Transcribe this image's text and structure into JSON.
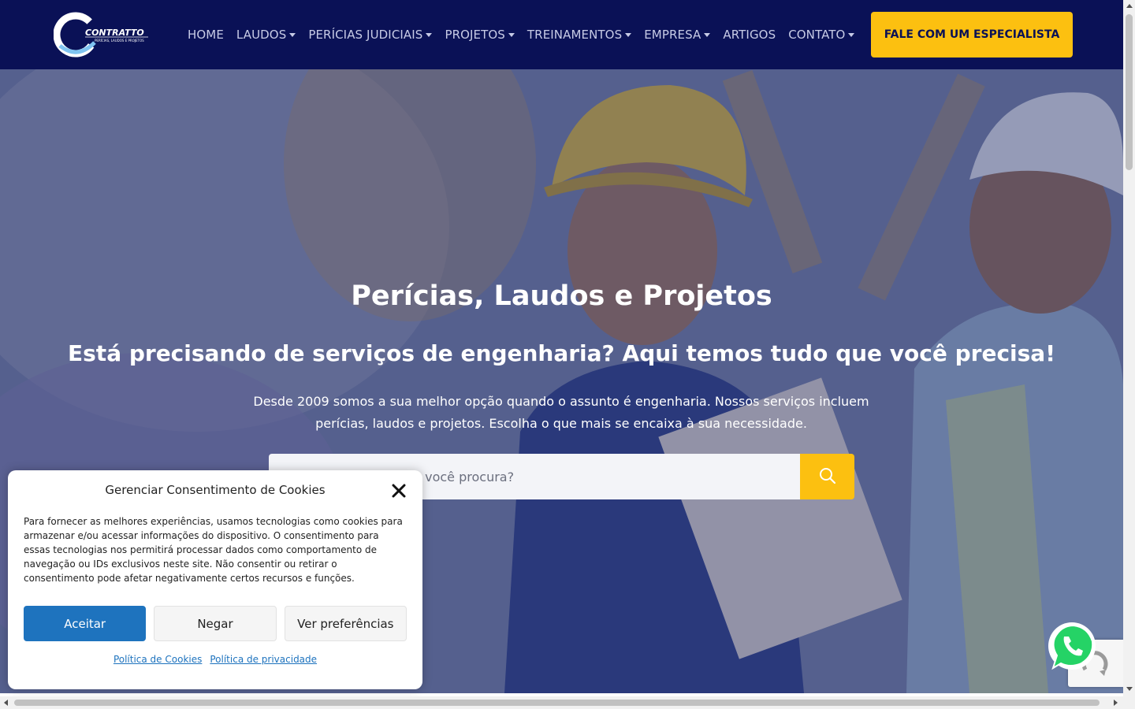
{
  "brand": {
    "logo_text": "CONTRATTO",
    "logo_tagline": "PERÍCIAS, LAUDOS E PROJETOS"
  },
  "nav": {
    "items": [
      {
        "label": "HOME",
        "dropdown": false
      },
      {
        "label": "LAUDOS",
        "dropdown": true
      },
      {
        "label": "PERÍCIAS JUDICIAIS",
        "dropdown": true
      },
      {
        "label": "PROJETOS",
        "dropdown": true
      },
      {
        "label": "TREINAMENTOS",
        "dropdown": true
      },
      {
        "label": "EMPRESA",
        "dropdown": true
      },
      {
        "label": "ARTIGOS",
        "dropdown": false
      },
      {
        "label": "CONTATO",
        "dropdown": true
      }
    ],
    "cta_label": "FALE COM UM ESPECIALISTA"
  },
  "hero": {
    "title": "Perícias, Laudos e Projetos",
    "subtitle": "Está precisando de serviços de engenharia? Aqui temos tudo que você precisa!",
    "description": "Desde 2009 somos a sua melhor opção quando o assunto é engenharia. Nossos serviços incluem perícias, laudos e projetos. Escolha o que mais se encaixa à sua necessidade.",
    "search_placeholder": "Qual laudo ou projeto você procura?"
  },
  "cookie": {
    "title": "Gerenciar Consentimento de Cookies",
    "text": "Para fornecer as melhores experiências, usamos tecnologias como cookies para armazenar e/ou acessar informações do dispositivo. O consentimento para essas tecnologias nos permitirá processar dados como comportamento de navegação ou IDs exclusivos neste site. Não consentir ou retirar o consentimento pode afetar negativamente certos recursos e funções.",
    "accept_label": "Aceitar",
    "deny_label": "Negar",
    "prefs_label": "Ver preferências",
    "cookie_policy_label": "Política de Cookies",
    "privacy_policy_label": "Política de privacidade"
  },
  "colors": {
    "navbar": "#0a1156",
    "accent": "#fcc010",
    "primary_button": "#1e73be",
    "whatsapp": "#25d366"
  },
  "icons": [
    "search-icon",
    "close-icon",
    "whatsapp-icon",
    "recaptcha-icon",
    "caret-down-icon"
  ]
}
